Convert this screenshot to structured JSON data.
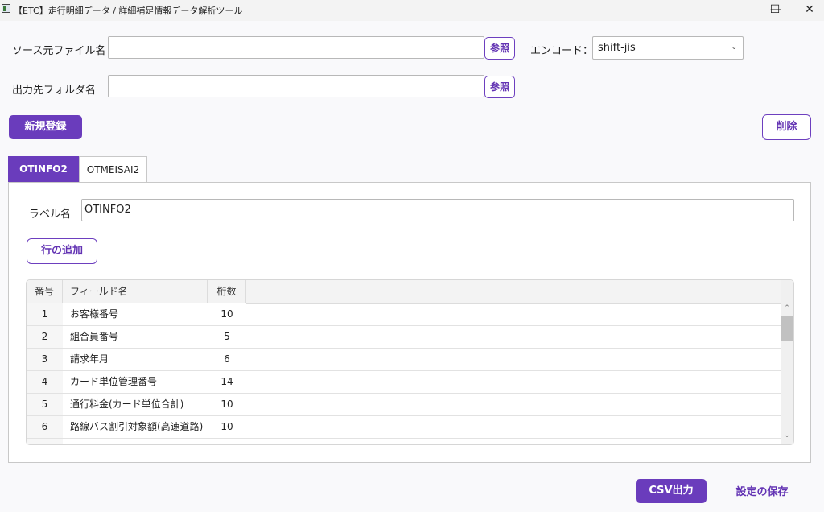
{
  "window": {
    "title": "【ETC】走行明細データ / 詳細補足情報データ解析ツール",
    "minimize": "—",
    "maximize": "☐",
    "close": "✕"
  },
  "source": {
    "label": "ソース元ファイル名",
    "value": "",
    "browse": "参照"
  },
  "encoding": {
    "label": "エンコード：",
    "value": "shift-jis",
    "chevron": "⌄"
  },
  "output": {
    "label": "出力先フォルダ名",
    "value": "",
    "browse": "参照"
  },
  "actions": {
    "new": "新規登録",
    "delete": "削除",
    "add_row": "行の追加",
    "csv": "CSV出力",
    "save": "設定の保存"
  },
  "tabs": [
    "OTINFO2",
    "OTMEISAI2"
  ],
  "panel": {
    "label_caption": "ラベル名",
    "label_value": "OTINFO2"
  },
  "grid": {
    "headers": [
      "番号",
      "フィールド名",
      "桁数"
    ],
    "rows": [
      [
        "1",
        "お客様番号",
        "10"
      ],
      [
        "2",
        "組合員番号",
        "5"
      ],
      [
        "3",
        "請求年月",
        "6"
      ],
      [
        "4",
        "カード単位管理番号",
        "14"
      ],
      [
        "5",
        "通行料金(カード単位合計)",
        "10"
      ],
      [
        "6",
        "路線バス割引対象額(高速道路)",
        "10"
      ]
    ],
    "scroll_up": "⌃",
    "scroll_down": "⌄"
  },
  "colors": {
    "accent": "#6a3cbc",
    "accent_text": "#6232b3"
  }
}
